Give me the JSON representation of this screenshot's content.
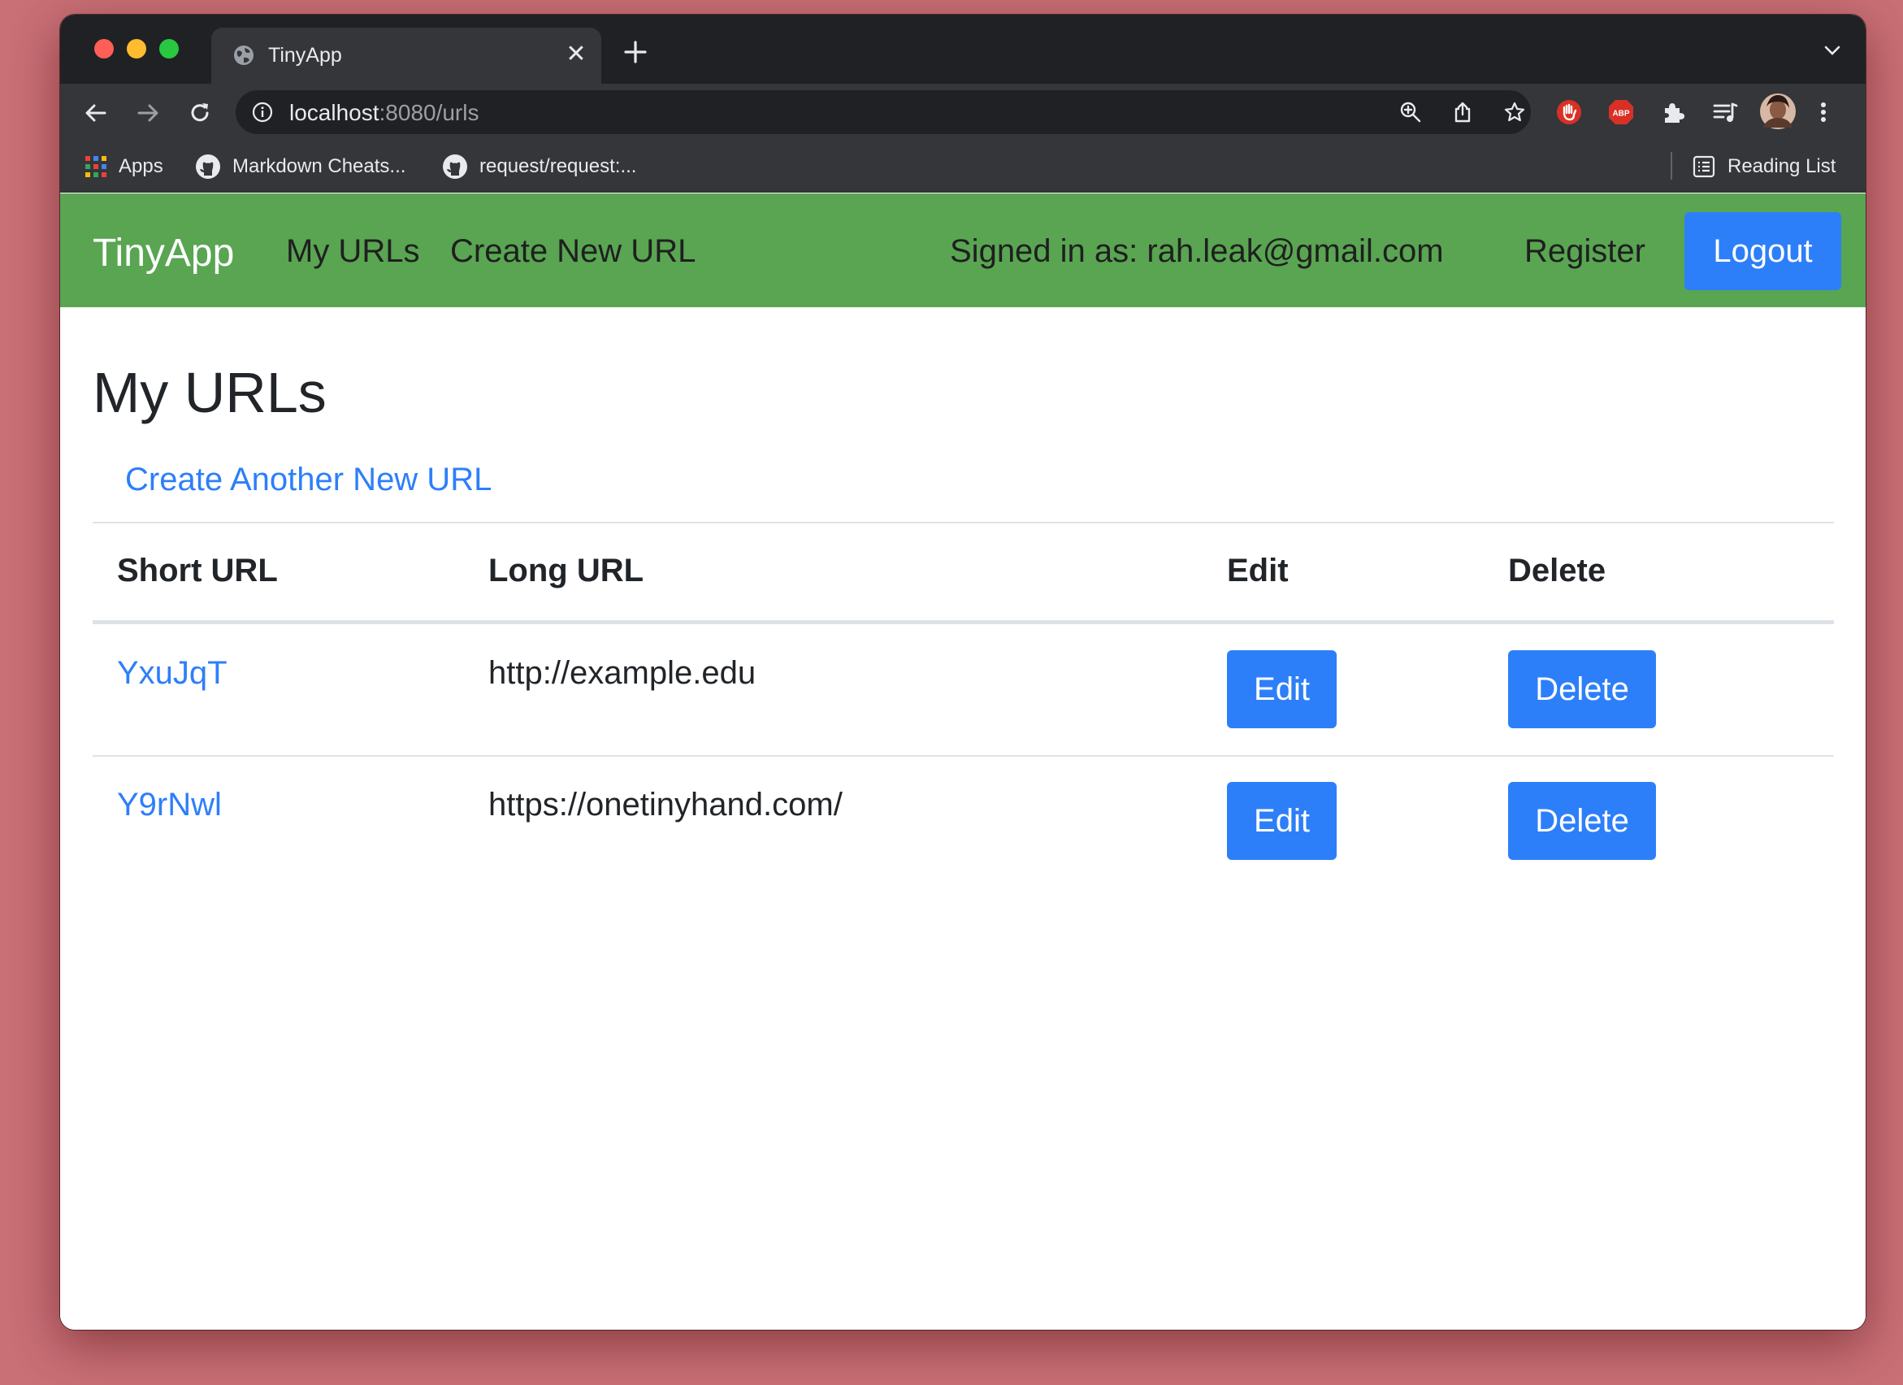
{
  "browser": {
    "tab_title": "TinyApp",
    "url_host": "localhost",
    "url_rest": ":8080/urls",
    "bookmarks": [
      {
        "label": "Apps",
        "icon": "apps-grid-icon"
      },
      {
        "label": "Markdown Cheats...",
        "icon": "github-icon"
      },
      {
        "label": "request/request:...",
        "icon": "github-icon"
      }
    ],
    "reading_list": "Reading List",
    "colors": {
      "frame": "#202124",
      "toolbar": "#35363a",
      "text": "#e8eaed"
    }
  },
  "navbar": {
    "brand": "TinyApp",
    "my_urls": "My URLs",
    "create_new": "Create New URL",
    "signed_in": "Signed in as: rah.leak@gmail.com",
    "register": "Register",
    "logout": "Logout",
    "colors": {
      "background": "#59a552",
      "button": "#2d7ff9"
    }
  },
  "page": {
    "title": "My URLs",
    "create_another": "Create Another New URL"
  },
  "table": {
    "headers": {
      "short": "Short URL",
      "long": "Long URL",
      "edit": "Edit",
      "delete": "Delete"
    },
    "rows": [
      {
        "short": "YxuJqT",
        "long": "http://example.edu",
        "edit": "Edit",
        "delete": "Delete"
      },
      {
        "short": "Y9rNwl",
        "long": "https://onetinyhand.com/",
        "edit": "Edit",
        "delete": "Delete"
      }
    ]
  }
}
